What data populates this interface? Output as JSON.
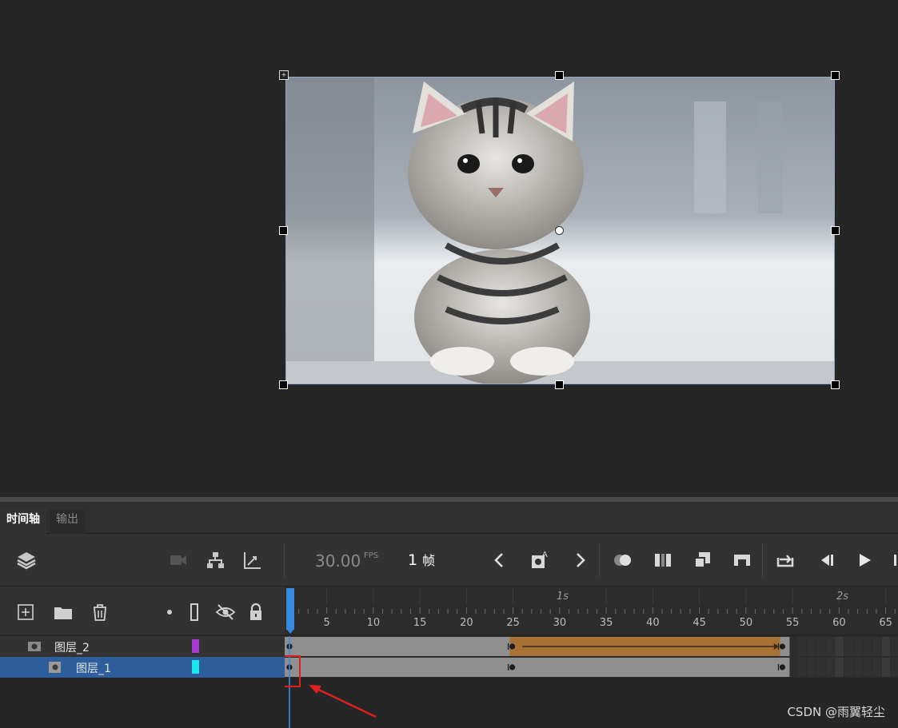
{
  "panel": {
    "tabs": [
      {
        "label": "时间轴",
        "active": true
      },
      {
        "label": "输出",
        "active": false
      }
    ]
  },
  "toolbar": {
    "fps_value": "30.00",
    "fps_unit": "FPS",
    "frame_value": "1",
    "frame_unit": "帧"
  },
  "ruler": {
    "seconds": [
      "1s",
      "2s"
    ],
    "frame_numbers": [
      "5",
      "10",
      "15",
      "20",
      "25",
      "30",
      "35",
      "40",
      "45",
      "50",
      "55",
      "60",
      "65"
    ]
  },
  "layers": [
    {
      "name": "图层_2",
      "color": "#a43cd4",
      "selected": false
    },
    {
      "name": "图层_1",
      "color": "#19e6f0",
      "selected": true
    }
  ],
  "timeline": {
    "playhead_frame": 1,
    "tween_color": "#a97235",
    "selection_color": "#2d5d9b"
  },
  "watermark": "CSDN @雨翼轻尘"
}
